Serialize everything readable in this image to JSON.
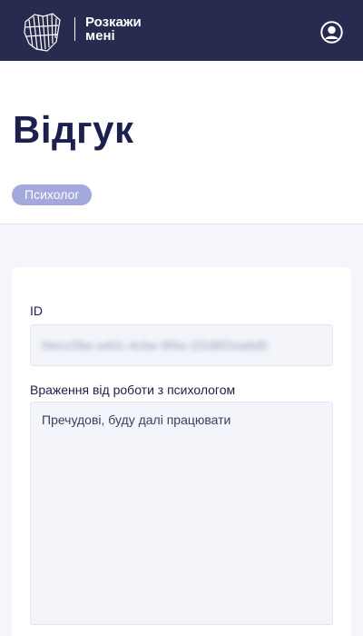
{
  "header": {
    "logo_line1": "Розкажи",
    "logo_line2": "мені",
    "logo_icon": "brain-icon",
    "profile_icon": "user-circle-icon"
  },
  "page": {
    "title": "Відгук",
    "role_badge": "Психолог"
  },
  "form": {
    "id_label": "ID",
    "id_value": "f4ecc5be-a40c-4cbe-9f4a-1f2d8f2ea8d5",
    "feedback_label": "Враження від роботи з психологом",
    "feedback_value": "Пречудові, буду далі працювати"
  },
  "colors": {
    "header_bg": "#262b4f",
    "title": "#1b2050",
    "badge_bg": "#a3a8dd",
    "page_bg": "#f4f6fb",
    "field_bg": "#f3f5fb"
  }
}
